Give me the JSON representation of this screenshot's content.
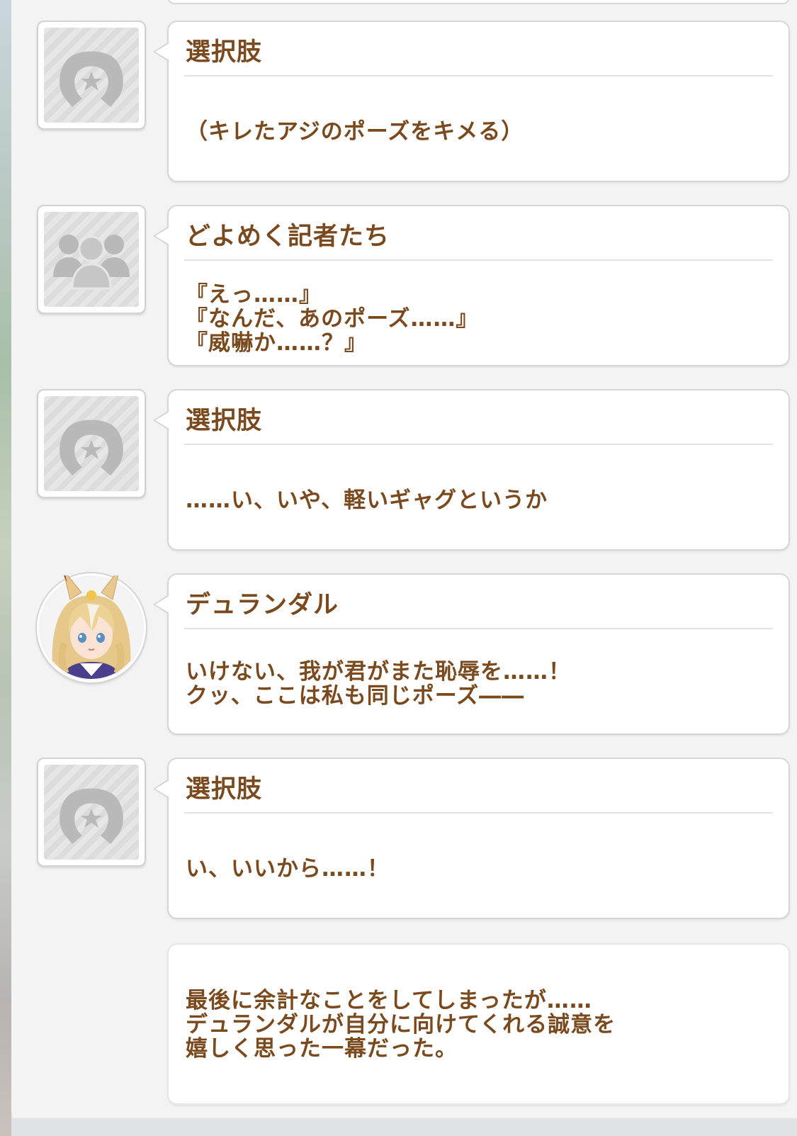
{
  "log": {
    "entries": [
      {
        "speaker": "選択肢",
        "avatar": "horseshoe-icon",
        "lines": [
          "（キレたアジのポーズをキメる）"
        ]
      },
      {
        "speaker": "どよめく記者たち",
        "avatar": "crowd-icon",
        "lines": [
          "『えっ……』",
          "『なんだ、あのポーズ……』",
          "『威嚇か……？』"
        ]
      },
      {
        "speaker": "選択肢",
        "avatar": "horseshoe-icon",
        "lines": [
          "……い、いや、軽いギャグというか"
        ]
      },
      {
        "speaker": "デュランダル",
        "avatar": "character-portrait",
        "lines": [
          "いけない、我が君がまた恥辱を……！",
          "クッ、ここは私も同じポーズ――"
        ]
      },
      {
        "speaker": "選択肢",
        "avatar": "horseshoe-icon",
        "lines": [
          "い、いいから……！"
        ]
      }
    ],
    "narration": {
      "lines": [
        "最後に余計なことをしてしまったが……",
        "デュランダルが自分に向けてくれる誠意を",
        "嬉しく思った一幕だった。"
      ]
    }
  },
  "colors": {
    "text_brown": "#7a4a1e",
    "bubble_border": "#d6d6d6",
    "panel_bg": "#f3f3f3"
  }
}
